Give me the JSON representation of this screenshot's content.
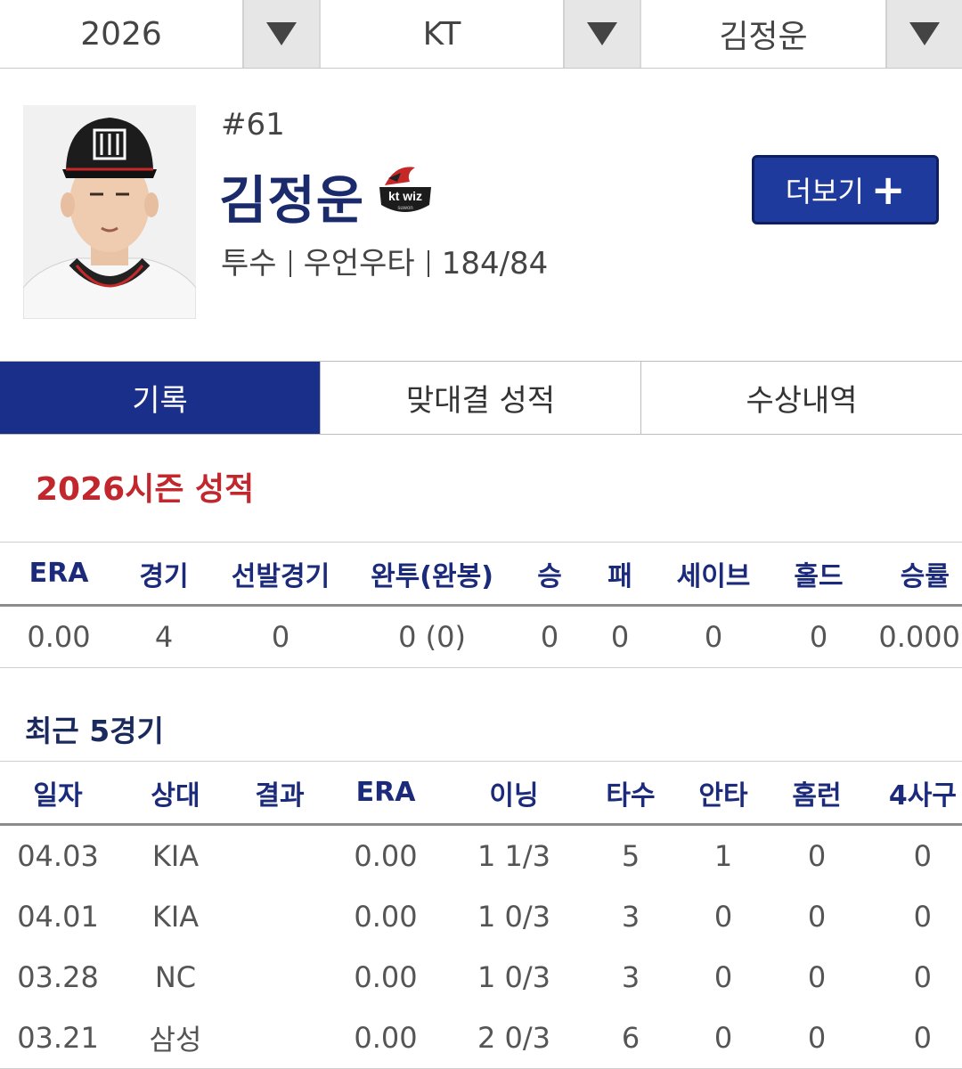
{
  "selectors": [
    {
      "value": "2026",
      "arrow_icon": "triangle-down"
    },
    {
      "value": "KT",
      "arrow_icon": "triangle-down"
    },
    {
      "value": "김정운",
      "arrow_icon": "triangle-down"
    }
  ],
  "player": {
    "number": "#61",
    "name": "김정운",
    "team_logo_text": "kt wiz",
    "team_logo_sub": "suwon",
    "position": "투수",
    "hand": "우언우타",
    "body": "184/84"
  },
  "more_button": {
    "label": "더보기",
    "icon": "+"
  },
  "tabs": [
    {
      "label": "기록",
      "active": true
    },
    {
      "label": "맞대결 성적",
      "active": false
    },
    {
      "label": "수상내역",
      "active": false
    }
  ],
  "season": {
    "title": "2026시즌 성적",
    "headers": [
      "ERA",
      "경기",
      "선발경기",
      "완투(완봉)",
      "승",
      "패",
      "세이브",
      "홀드",
      "승률"
    ],
    "values": [
      "0.00",
      "4",
      "0",
      "0 (0)",
      "0",
      "0",
      "0",
      "0",
      "0.000"
    ]
  },
  "recent": {
    "title": "최근 5경기",
    "headers": [
      "일자",
      "상대",
      "결과",
      "ERA",
      "이닝",
      "타수",
      "안타",
      "홈런",
      "4사구"
    ],
    "rows": [
      [
        "04.03",
        "KIA",
        "",
        "0.00",
        "1 1/3",
        "5",
        "1",
        "0",
        "0"
      ],
      [
        "04.01",
        "KIA",
        "",
        "0.00",
        "1 0/3",
        "3",
        "0",
        "0",
        "0"
      ],
      [
        "03.28",
        "NC",
        "",
        "0.00",
        "1 0/3",
        "3",
        "0",
        "0",
        "0"
      ],
      [
        "03.21",
        "삼성",
        "",
        "0.00",
        "2 0/3",
        "6",
        "0",
        "0",
        "0"
      ]
    ]
  },
  "colors": {
    "accent_navy": "#1a2f8a",
    "season_title_red": "#c1272d",
    "header_text_navy": "#1b2a7a"
  }
}
